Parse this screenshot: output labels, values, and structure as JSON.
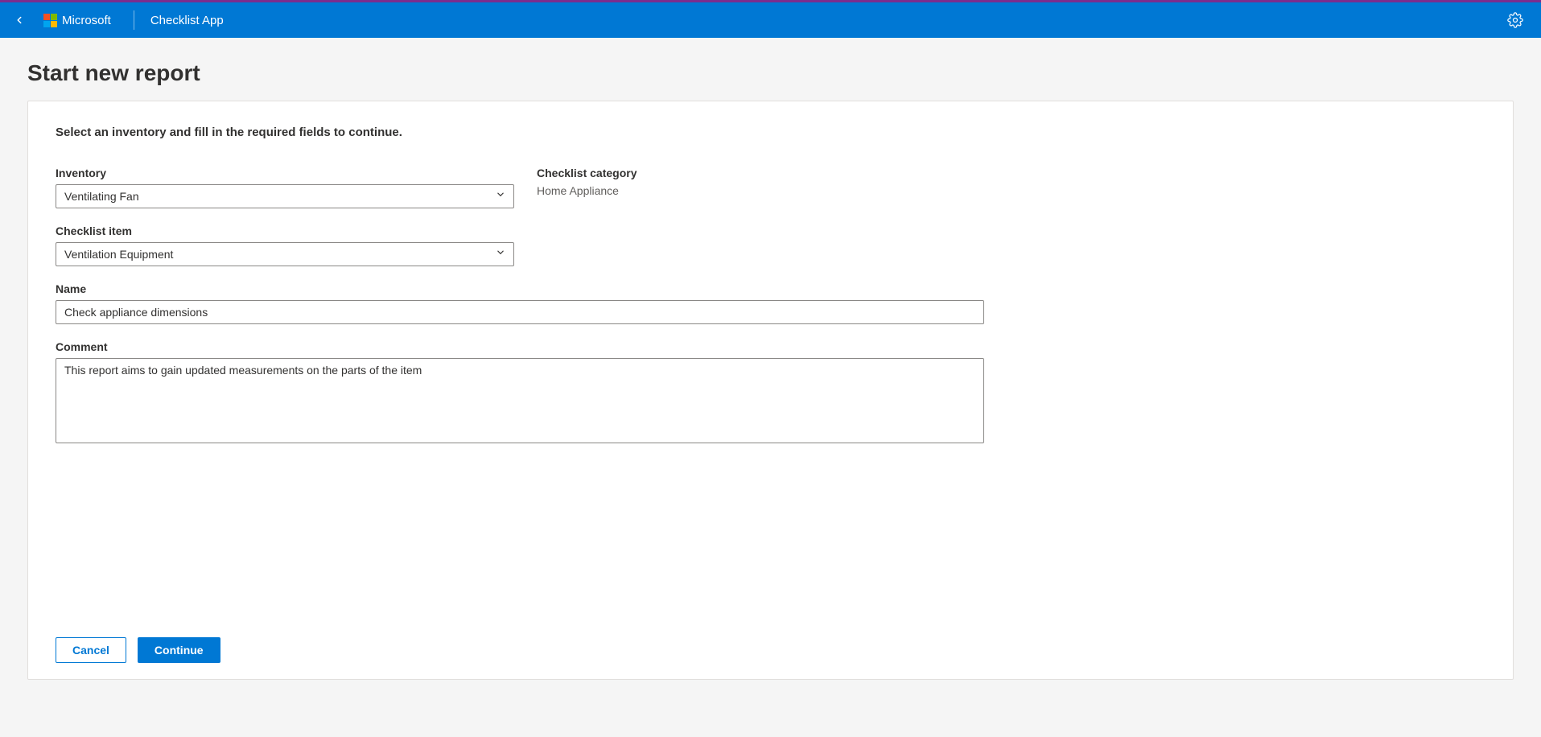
{
  "header": {
    "brand": "Microsoft",
    "app_title": "Checklist App"
  },
  "page": {
    "title": "Start new report",
    "instruction": "Select an inventory and fill in the required fields to continue."
  },
  "form": {
    "inventory": {
      "label": "Inventory",
      "value": "Ventilating Fan"
    },
    "category": {
      "label": "Checklist category",
      "value": "Home Appliance"
    },
    "checklist_item": {
      "label": "Checklist item",
      "value": "Ventilation Equipment"
    },
    "name": {
      "label": "Name",
      "value": "Check appliance dimensions"
    },
    "comment": {
      "label": "Comment",
      "value": "This report aims to gain updated measurements on the parts of the item"
    }
  },
  "buttons": {
    "cancel": "Cancel",
    "continue": "Continue"
  }
}
